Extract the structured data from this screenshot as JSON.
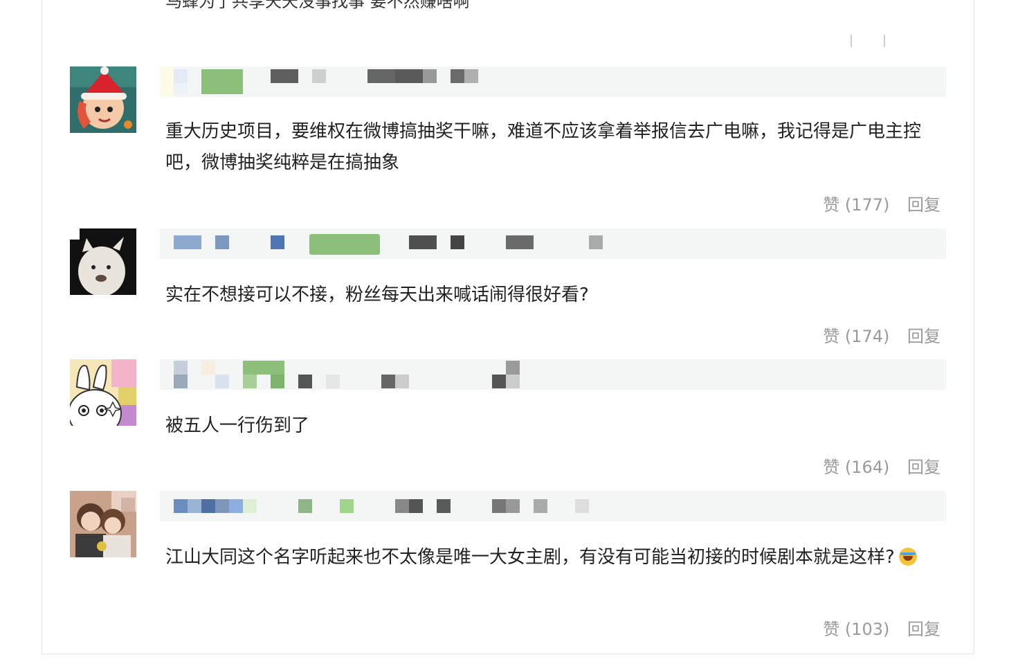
{
  "previous_comment": {
    "text": "马蜂为了共享天天没事找事 要不然赚啥啊"
  },
  "comments": [
    {
      "avatar_icon": "santa-hat-girl-avatar",
      "text": "重大历史项目，要维权在微博搞抽奖干嘛，难道不应该拿着举报信去广电嘛，我记得是广电主控吧，微博抽奖纯粹是在搞抽象",
      "like_label": "赞 (177)",
      "reply_label": "回复"
    },
    {
      "avatar_icon": "white-hamster-avatar",
      "text": "实在不想接可以不接，粉丝每天出来喊话闹得很好看?",
      "like_label": "赞 (174)",
      "reply_label": "回复"
    },
    {
      "avatar_icon": "cartoon-rabbit-avatar",
      "text": "被五人一行伤到了",
      "like_label": "赞 (164)",
      "reply_label": "回复"
    },
    {
      "avatar_icon": "couple-photo-avatar",
      "text": "江山大同这个名字听起来也不太像是唯一大女主剧，有没有可能当初接的时候剧本就是这样?",
      "emoji_icon": "laughing-tears-emoji",
      "like_label": "赞 (103)",
      "reply_label": "回复"
    }
  ],
  "colors": {
    "like_text": "#9a9a9a",
    "meta_bar": "#f4f6f5",
    "badge_green": "#8cc07a"
  }
}
